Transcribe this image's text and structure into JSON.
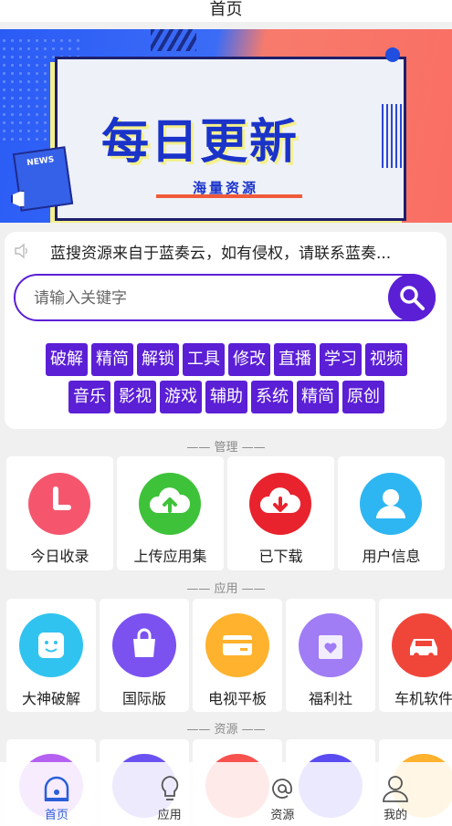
{
  "header": {
    "title": "首页"
  },
  "banner": {
    "headline": "每日更新",
    "subtitle": "海量资源",
    "news_badge": "NEWS"
  },
  "notice": {
    "text": "蓝搜资源来自于蓝奏云，如有侵权，请联系蓝奏..."
  },
  "search": {
    "placeholder": "请输入关键字"
  },
  "tags": {
    "row1": [
      "破解",
      "精简",
      "解锁",
      "工具",
      "修改",
      "直播",
      "学习",
      "视频"
    ],
    "row2": [
      "音乐",
      "影视",
      "游戏",
      "辅助",
      "系统",
      "精简",
      "原创"
    ]
  },
  "sections": {
    "manage": "—— 管理 ——",
    "apps": "—— 应用 ——",
    "resources": "—— 资源 ——"
  },
  "manage": [
    {
      "label": "今日收录",
      "icon": "clock-icon",
      "color": "#f5566e"
    },
    {
      "label": "上传应用集",
      "icon": "cloud-upload-icon",
      "color": "#3ec23a"
    },
    {
      "label": "已下载",
      "icon": "cloud-download-icon",
      "color": "#e8232e"
    },
    {
      "label": "用户信息",
      "icon": "user-icon",
      "color": "#2eb6f2"
    }
  ],
  "apps": [
    {
      "label": "大神破解",
      "icon": "smiley-icon",
      "color": "#31c3f0"
    },
    {
      "label": "国际版",
      "icon": "shopping-bag-icon",
      "color": "#7b52f0"
    },
    {
      "label": "电视平板",
      "icon": "wallet-card-icon",
      "color": "#ffb22e"
    },
    {
      "label": "福利社",
      "icon": "heart-box-icon",
      "color": "#a07cf5"
    },
    {
      "label": "车机软件",
      "icon": "car-icon",
      "color": "#f0463a"
    }
  ],
  "resources": [
    {
      "icon": "resource-icon-1",
      "color": "#b460f0"
    },
    {
      "icon": "resource-icon-2",
      "color": "#6a52f0"
    },
    {
      "icon": "resource-icon-3",
      "color": "#f7524e"
    },
    {
      "icon": "resource-icon-4",
      "color": "#5a4cf0"
    },
    {
      "icon": "resource-icon-5",
      "color": "#ffb22e"
    }
  ],
  "tabbar": [
    {
      "label": "首页",
      "icon": "home-icon",
      "active": true
    },
    {
      "label": "应用",
      "icon": "lightbulb-icon",
      "active": false
    },
    {
      "label": "资源",
      "icon": "at-sign-icon",
      "active": false
    },
    {
      "label": "我的",
      "icon": "person-icon",
      "active": false
    }
  ],
  "colors": {
    "accent": "#5b1fd6",
    "tab_active": "#2b5fd9"
  }
}
